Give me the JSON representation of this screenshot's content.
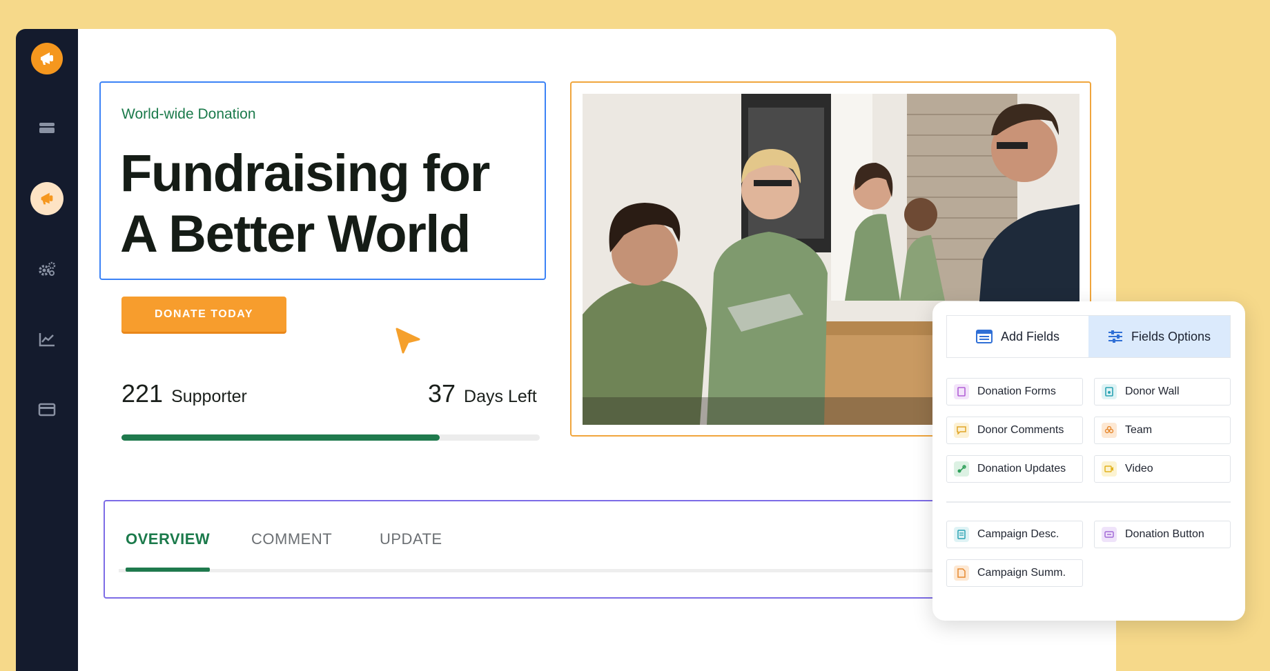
{
  "colors": {
    "background": "#f6d98a",
    "sidebar": "#141b2d",
    "accent_orange": "#f79d2d",
    "brand_green": "#1f7a4d",
    "hero_border": "#3b82f6",
    "tabs_border": "#7c6be6"
  },
  "sidebar": {
    "logo_icon": "megaphone-logo-icon",
    "items": [
      {
        "icon": "stack-icon"
      },
      {
        "icon": "megaphone-icon",
        "active": true
      },
      {
        "icon": "gears-icon"
      },
      {
        "icon": "chart-icon"
      },
      {
        "icon": "card-icon"
      }
    ]
  },
  "hero": {
    "eyebrow": "World-wide Donation",
    "headline": "Fundraising for A Better World"
  },
  "donate_button": {
    "label": "DONATE TODAY"
  },
  "stats": {
    "supporters": {
      "value": "221",
      "label": "Supporter"
    },
    "days_left": {
      "value": "37",
      "label": "Days Left"
    }
  },
  "progress": {
    "fraction": 0.76
  },
  "tabs": [
    {
      "label": "OVERVIEW",
      "active": true
    },
    {
      "label": "COMMENT"
    },
    {
      "label": "UPDATE"
    }
  ],
  "panel": {
    "segments": [
      {
        "label": "Add Fields",
        "icon": "list-icon"
      },
      {
        "label": "Fields Options",
        "icon": "sliders-icon",
        "active": true
      }
    ],
    "fields_group1": [
      {
        "label": "Donation Forms",
        "icon": "form-icon",
        "color": "#b15fd6"
      },
      {
        "label": "Donor Wall",
        "icon": "wall-icon",
        "color": "#2aa3b3"
      },
      {
        "label": "Donor Comments",
        "icon": "comment-icon",
        "color": "#e0a526"
      },
      {
        "label": "Team",
        "icon": "team-icon",
        "color": "#e7892f"
      },
      {
        "label": "Donation Updates",
        "icon": "updates-icon",
        "color": "#2f9f5a"
      },
      {
        "label": "Video",
        "icon": "video-icon",
        "color": "#e2b21d"
      }
    ],
    "fields_group2": [
      {
        "label": "Campaign Desc.",
        "icon": "desc-icon",
        "color": "#2aa3b3"
      },
      {
        "label": "Donation Button",
        "icon": "button-icon",
        "color": "#a26ad6"
      },
      {
        "label": "Campaign Summ.",
        "icon": "summary-icon",
        "color": "#e7892f"
      }
    ]
  }
}
